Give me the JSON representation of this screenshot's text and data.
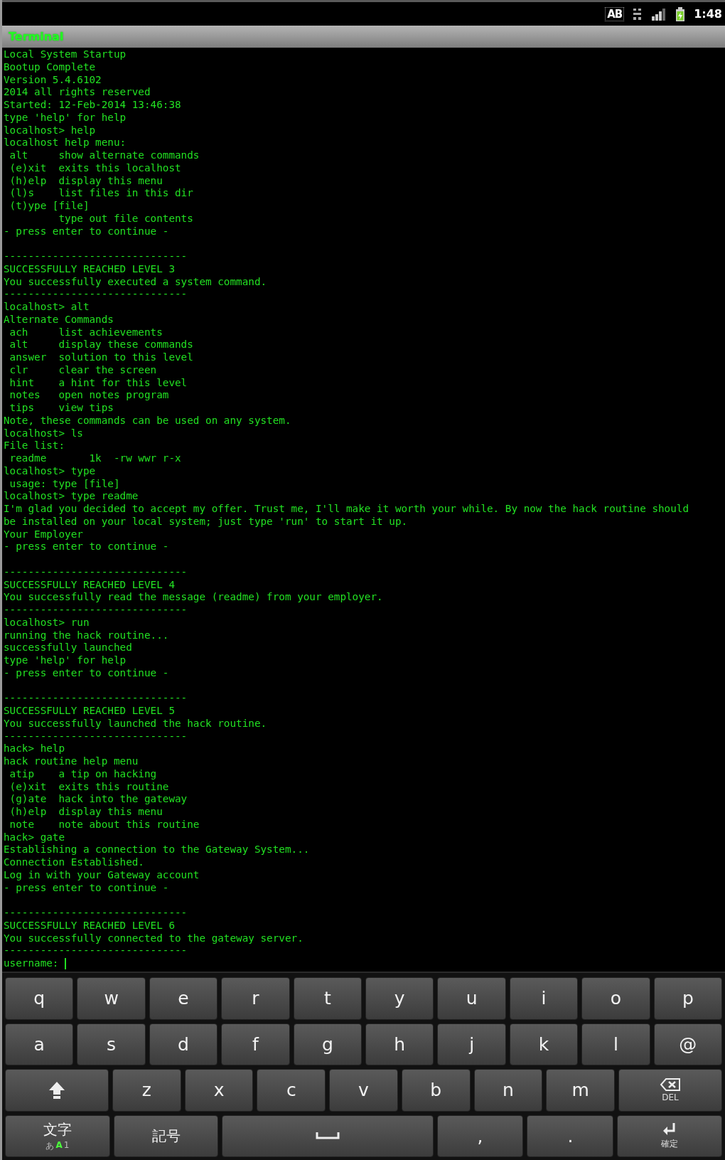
{
  "status_bar": {
    "ime_indicator": "AB",
    "time": "1:48"
  },
  "window": {
    "title": "Terminal"
  },
  "terminal": {
    "lines": [
      {
        "kind": "text",
        "text": "Local System Startup"
      },
      {
        "kind": "text",
        "text": "Bootup Complete"
      },
      {
        "kind": "text",
        "text": "Version 5.4.6102"
      },
      {
        "kind": "text",
        "text": "2014 all rights reserved"
      },
      {
        "kind": "text",
        "text": "Started: 12-Feb-2014 13:46:38"
      },
      {
        "kind": "text",
        "text": "type 'help' for help"
      },
      {
        "kind": "text",
        "text": "localhost> help"
      },
      {
        "kind": "text",
        "text": "localhost help menu:"
      },
      {
        "kind": "text",
        "text": " alt     show alternate commands"
      },
      {
        "kind": "text",
        "text": " (e)xit  exits this localhost"
      },
      {
        "kind": "text",
        "text": " (h)elp  display this menu"
      },
      {
        "kind": "text",
        "text": " (l)s    list files in this dir"
      },
      {
        "kind": "text",
        "text": " (t)ype [file]"
      },
      {
        "kind": "text",
        "text": "         type out file contents"
      },
      {
        "kind": "text",
        "text": "- press enter to continue -"
      },
      {
        "kind": "blank"
      },
      {
        "kind": "text",
        "text": "------------------------------"
      },
      {
        "kind": "text",
        "text": "SUCCESSFULLY REACHED LEVEL 3"
      },
      {
        "kind": "text",
        "text": "You successfully executed a system command."
      },
      {
        "kind": "text",
        "text": "------------------------------"
      },
      {
        "kind": "text",
        "text": "localhost> alt"
      },
      {
        "kind": "text",
        "text": "Alternate Commands"
      },
      {
        "kind": "text",
        "text": " ach     list achievements"
      },
      {
        "kind": "text",
        "text": " alt     display these commands"
      },
      {
        "kind": "text",
        "text": " answer  solution to this level"
      },
      {
        "kind": "text",
        "text": " clr     clear the screen"
      },
      {
        "kind": "text",
        "text": " hint    a hint for this level"
      },
      {
        "kind": "text",
        "text": " notes   open notes program"
      },
      {
        "kind": "text",
        "text": " tips    view tips"
      },
      {
        "kind": "text",
        "text": "Note, these commands can be used on any system."
      },
      {
        "kind": "text",
        "text": "localhost> ls"
      },
      {
        "kind": "text",
        "text": "File list:"
      },
      {
        "kind": "text",
        "text": " readme       1k  -rw wwr r-x"
      },
      {
        "kind": "text",
        "text": "localhost> type"
      },
      {
        "kind": "text",
        "text": " usage: type [file]"
      },
      {
        "kind": "text",
        "text": "localhost> type readme"
      },
      {
        "kind": "text",
        "text": "I'm glad you decided to accept my offer. Trust me, I'll make it worth your while. By now the hack routine should"
      },
      {
        "kind": "text",
        "text": "be installed on your local system; just type 'run' to start it up."
      },
      {
        "kind": "text",
        "text": "Your Employer"
      },
      {
        "kind": "text",
        "text": "- press enter to continue -"
      },
      {
        "kind": "blank"
      },
      {
        "kind": "text",
        "text": "------------------------------"
      },
      {
        "kind": "text",
        "text": "SUCCESSFULLY REACHED LEVEL 4"
      },
      {
        "kind": "text",
        "text": "You successfully read the message (readme) from your employer."
      },
      {
        "kind": "text",
        "text": "------------------------------"
      },
      {
        "kind": "text",
        "text": "localhost> run"
      },
      {
        "kind": "text",
        "text": "running the hack routine..."
      },
      {
        "kind": "text",
        "text": "successfully launched"
      },
      {
        "kind": "text",
        "text": "type 'help' for help"
      },
      {
        "kind": "text",
        "text": "- press enter to continue -"
      },
      {
        "kind": "blank"
      },
      {
        "kind": "text",
        "text": "------------------------------"
      },
      {
        "kind": "text",
        "text": "SUCCESSFULLY REACHED LEVEL 5"
      },
      {
        "kind": "text",
        "text": "You successfully launched the hack routine."
      },
      {
        "kind": "text",
        "text": "------------------------------"
      },
      {
        "kind": "text",
        "text": "hack> help"
      },
      {
        "kind": "text",
        "text": "hack routine help menu"
      },
      {
        "kind": "text",
        "text": " atip    a tip on hacking"
      },
      {
        "kind": "text",
        "text": " (e)xit  exits this routine"
      },
      {
        "kind": "text",
        "text": " (g)ate  hack into the gateway"
      },
      {
        "kind": "text",
        "text": " (h)elp  display this menu"
      },
      {
        "kind": "text",
        "text": " note    note about this routine"
      },
      {
        "kind": "text",
        "text": "hack> gate"
      },
      {
        "kind": "text",
        "text": "Establishing a connection to the Gateway System..."
      },
      {
        "kind": "text",
        "text": "Connection Established."
      },
      {
        "kind": "text",
        "text": "Log in with your Gateway account"
      },
      {
        "kind": "text",
        "text": "- press enter to continue -"
      },
      {
        "kind": "blank"
      },
      {
        "kind": "text",
        "text": "------------------------------"
      },
      {
        "kind": "text",
        "text": "SUCCESSFULLY REACHED LEVEL 6"
      },
      {
        "kind": "text",
        "text": "You successfully connected to the gateway server."
      },
      {
        "kind": "text",
        "text": "------------------------------"
      },
      {
        "kind": "prompt",
        "text": "username:"
      }
    ]
  },
  "keyboard": {
    "rows": [
      [
        {
          "kind": "char",
          "label": "q"
        },
        {
          "kind": "char",
          "label": "w"
        },
        {
          "kind": "char",
          "label": "e"
        },
        {
          "kind": "char",
          "label": "r"
        },
        {
          "kind": "char",
          "label": "t"
        },
        {
          "kind": "char",
          "label": "y"
        },
        {
          "kind": "char",
          "label": "u"
        },
        {
          "kind": "char",
          "label": "i"
        },
        {
          "kind": "char",
          "label": "o"
        },
        {
          "kind": "char",
          "label": "p"
        }
      ],
      [
        {
          "kind": "char",
          "label": "a"
        },
        {
          "kind": "char",
          "label": "s"
        },
        {
          "kind": "char",
          "label": "d"
        },
        {
          "kind": "char",
          "label": "f"
        },
        {
          "kind": "char",
          "label": "g"
        },
        {
          "kind": "char",
          "label": "h"
        },
        {
          "kind": "char",
          "label": "j"
        },
        {
          "kind": "char",
          "label": "k"
        },
        {
          "kind": "char",
          "label": "l"
        },
        {
          "kind": "char",
          "label": "@"
        }
      ],
      [
        {
          "kind": "shift"
        },
        {
          "kind": "char",
          "label": "z"
        },
        {
          "kind": "char",
          "label": "x"
        },
        {
          "kind": "char",
          "label": "c"
        },
        {
          "kind": "char",
          "label": "v"
        },
        {
          "kind": "char",
          "label": "b"
        },
        {
          "kind": "char",
          "label": "n"
        },
        {
          "kind": "char",
          "label": "m"
        },
        {
          "kind": "delete",
          "label": "DEL"
        }
      ],
      [
        {
          "kind": "mode",
          "label": "文字",
          "modes": [
            {
              "label": "あ",
              "selected": false
            },
            {
              "label": "A",
              "selected": true
            },
            {
              "label": "1",
              "selected": false
            }
          ]
        },
        {
          "kind": "symbols",
          "label": "記号"
        },
        {
          "kind": "space"
        },
        {
          "kind": "punct",
          "label": ","
        },
        {
          "kind": "punct",
          "label": "."
        },
        {
          "kind": "enter",
          "label": "確定"
        }
      ]
    ]
  }
}
